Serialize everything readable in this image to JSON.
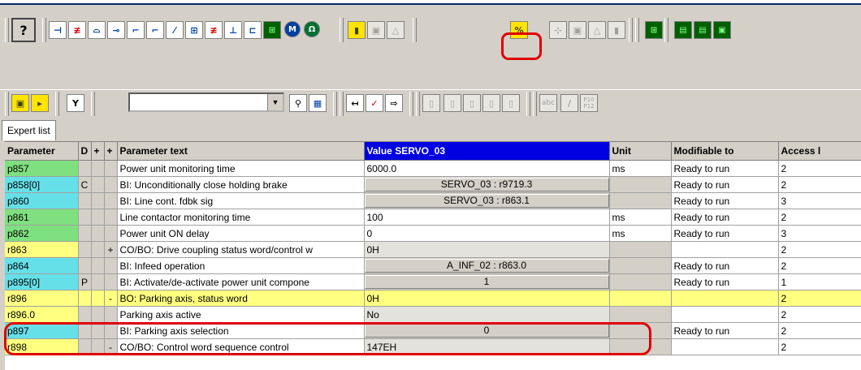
{
  "colors": {
    "highlight_red": "#e00000",
    "value_header_blue": "#0000e0",
    "param_green": "#7fe07f",
    "param_cyan": "#66e0e8",
    "param_yellow": "#ffff80"
  },
  "toolbar1": {
    "help_icon": "?",
    "buttons": [
      "⊣",
      "≢",
      "⌓",
      "⊸",
      "⌐",
      "⌐",
      "⁄",
      "⊞",
      "≢",
      "⊥",
      "⊏",
      "⊞",
      "M",
      "Ω",
      "▮",
      "▣",
      "△",
      "%",
      "⊹",
      "▣",
      "△",
      "▮",
      "⊞",
      "▤",
      "▤",
      "▣"
    ]
  },
  "toolbar2": {
    "buttons_left": [
      "▣",
      "▸"
    ],
    "filter_icon": "Y",
    "combo_value": "",
    "combo_arrow": "▼",
    "search_buttons": [
      "⚲",
      "▦"
    ],
    "nav_buttons": [
      "↤",
      "✓",
      "⇨"
    ],
    "edit_buttons": [
      "▯",
      "▯",
      "▯",
      "▯",
      "▯"
    ],
    "text_buttons": [
      "abc",
      "/",
      "P10\nP12"
    ]
  },
  "tabs": [
    "Expert list"
  ],
  "table": {
    "headers": [
      "Parameter",
      "D",
      "+",
      "+",
      "Parameter text",
      "Value SERVO_03",
      "Unit",
      "Modifiable to",
      "Access l"
    ],
    "rows": [
      {
        "param": "p857",
        "d": "",
        "p1": "",
        "p2": "",
        "text": "Power unit monitoring time",
        "value": "6000.0",
        "unit": "ms",
        "mod": "Ready to run",
        "access": "2",
        "style": "green",
        "valtype": "white"
      },
      {
        "param": "p858[0]",
        "d": "C",
        "p1": "",
        "p2": "",
        "text": "BI: Unconditionally close holding brake",
        "value": "SERVO_03 : r9719.3",
        "unit": "",
        "mod": "Ready to run",
        "access": "2",
        "style": "cyan",
        "valtype": "button"
      },
      {
        "param": "p860",
        "d": "",
        "p1": "",
        "p2": "",
        "text": "BI: Line cont. fdbk sig",
        "value": "SERVO_03 : r863.1",
        "unit": "",
        "mod": "Ready to run",
        "access": "3",
        "style": "cyan",
        "valtype": "button"
      },
      {
        "param": "p861",
        "d": "",
        "p1": "",
        "p2": "",
        "text": "Line contactor monitoring time",
        "value": "100",
        "unit": "ms",
        "mod": "Ready to run",
        "access": "2",
        "style": "green",
        "valtype": "white"
      },
      {
        "param": "p862",
        "d": "",
        "p1": "",
        "p2": "",
        "text": "Power unit ON delay",
        "value": "0",
        "unit": "ms",
        "mod": "Ready to run",
        "access": "3",
        "style": "green",
        "valtype": "white"
      },
      {
        "param": "r863",
        "d": "",
        "p1": "",
        "p2": "+",
        "text": "CO/BO: Drive coupling status word/control w",
        "value": "0H",
        "unit": "",
        "mod": "",
        "access": "2",
        "style": "yellow",
        "valtype": "gray"
      },
      {
        "param": "p864",
        "d": "",
        "p1": "",
        "p2": "",
        "text": "BI: Infeed operation",
        "value": "A_INF_02 : r863.0",
        "unit": "",
        "mod": "Ready to run",
        "access": "2",
        "style": "cyan",
        "valtype": "button"
      },
      {
        "param": "p895[0]",
        "d": "P",
        "p1": "",
        "p2": "",
        "text": "BI: Activate/de-activate power unit compone",
        "value": "1",
        "unit": "",
        "mod": "Ready to run",
        "access": "1",
        "style": "cyan",
        "valtype": "button"
      },
      {
        "param": "r896",
        "d": "",
        "p1": "",
        "p2": "-",
        "text": "BO: Parking axis, status word",
        "value": "0H",
        "unit": "",
        "mod": "",
        "access": "2",
        "style": "yellow",
        "valtype": "yrow"
      },
      {
        "param": "r896.0",
        "d": "",
        "p1": "",
        "p2": "",
        "text": "Parking axis active",
        "value": "No",
        "unit": "",
        "mod": "",
        "access": "2",
        "style": "yellow",
        "valtype": "gray"
      },
      {
        "param": "p897",
        "d": "",
        "p1": "",
        "p2": "",
        "text": "BI: Parking axis selection",
        "value": "0",
        "unit": "",
        "mod": "Ready to run",
        "access": "2",
        "style": "cyan",
        "valtype": "button"
      },
      {
        "param": "r898",
        "d": "",
        "p1": "",
        "p2": "-",
        "text": "CO/BO: Control word sequence control",
        "value": "147EH",
        "unit": "",
        "mod": "",
        "access": "2",
        "style": "yellow",
        "valtype": "gray"
      }
    ]
  }
}
